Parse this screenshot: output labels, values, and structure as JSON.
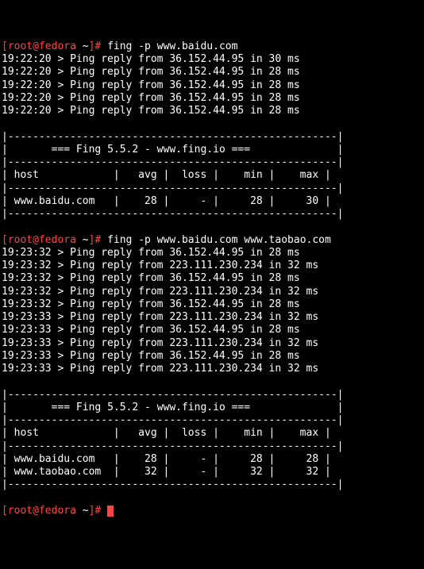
{
  "prompt1": {
    "user": "root",
    "host": "fedora",
    "dir": "~",
    "cmd": "fing -p www.baidu.com"
  },
  "ping1": [
    {
      "time": "19:22:20",
      "ip": "36.152.44.95",
      "ms": "30"
    },
    {
      "time": "19:22:20",
      "ip": "36.152.44.95",
      "ms": "28"
    },
    {
      "time": "19:22:20",
      "ip": "36.152.44.95",
      "ms": "28"
    },
    {
      "time": "19:22:20",
      "ip": "36.152.44.95",
      "ms": "28"
    },
    {
      "time": "19:22:20",
      "ip": "36.152.44.95",
      "ms": "28"
    }
  ],
  "banner": "=== Fing 5.5.2 - www.fing.io ===",
  "headers": {
    "host": "host",
    "avg": "avg",
    "loss": "loss",
    "min": "min",
    "max": "max"
  },
  "table1": [
    {
      "host": "www.baidu.com",
      "avg": "28",
      "loss": "-",
      "min": "28",
      "max": "30"
    }
  ],
  "prompt2": {
    "user": "root",
    "host": "fedora",
    "dir": "~",
    "cmd": "fing -p www.baidu.com www.taobao.com"
  },
  "ping2": [
    {
      "time": "19:23:32",
      "ip": "36.152.44.95",
      "ms": "28"
    },
    {
      "time": "19:23:32",
      "ip": "223.111.230.234",
      "ms": "32"
    },
    {
      "time": "19:23:32",
      "ip": "36.152.44.95",
      "ms": "28"
    },
    {
      "time": "19:23:32",
      "ip": "223.111.230.234",
      "ms": "32"
    },
    {
      "time": "19:23:32",
      "ip": "36.152.44.95",
      "ms": "28"
    },
    {
      "time": "19:23:33",
      "ip": "223.111.230.234",
      "ms": "32"
    },
    {
      "time": "19:23:33",
      "ip": "36.152.44.95",
      "ms": "28"
    },
    {
      "time": "19:23:33",
      "ip": "223.111.230.234",
      "ms": "32"
    },
    {
      "time": "19:23:33",
      "ip": "36.152.44.95",
      "ms": "28"
    },
    {
      "time": "19:23:33",
      "ip": "223.111.230.234",
      "ms": "32"
    }
  ],
  "table2": [
    {
      "host": "www.baidu.com",
      "avg": "28",
      "loss": "-",
      "min": "28",
      "max": "28"
    },
    {
      "host": "www.taobao.com",
      "avg": "32",
      "loss": "-",
      "min": "32",
      "max": "32"
    }
  ],
  "prompt3": {
    "user": "root",
    "host": "fedora",
    "dir": "~"
  }
}
